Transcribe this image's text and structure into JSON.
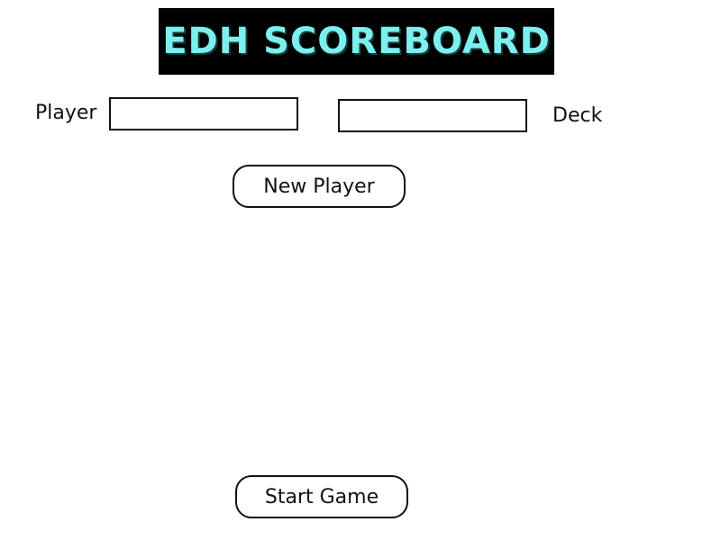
{
  "header": {
    "banner_title": "EDH SCOREBOARD",
    "banner_text_color": "#7cf0ee",
    "banner_background": "#000000"
  },
  "form": {
    "player_label": "Player",
    "player_value": "",
    "deck_label": "Deck",
    "deck_value": ""
  },
  "actions": {
    "new_player_label": "New Player",
    "start_game_label": "Start Game"
  }
}
